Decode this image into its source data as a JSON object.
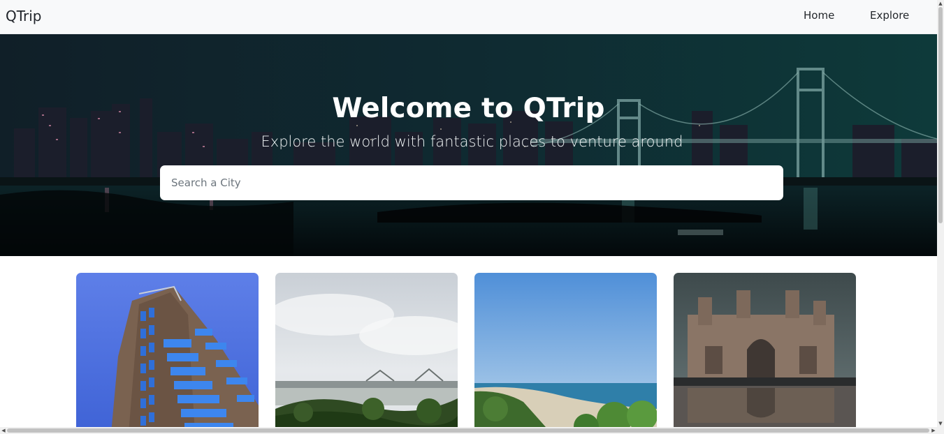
{
  "navbar": {
    "brand": "QTrip",
    "links": [
      {
        "label": "Home"
      },
      {
        "label": "Explore"
      }
    ]
  },
  "hero": {
    "title": "Welcome to QTrip",
    "subtitle": "Explore the world with fantastic places to venture around",
    "search_placeholder": "Search a City",
    "search_value": ""
  },
  "cities": [
    {
      "image": "glass-tower-photo"
    },
    {
      "image": "river-bridge-photo"
    },
    {
      "image": "beach-coast-photo"
    },
    {
      "image": "gateway-monument-photo"
    }
  ],
  "colors": {
    "navbar_bg": "#f8f9fa",
    "hero_overlay": "#0c2a2e",
    "text_light": "#ffffff"
  }
}
